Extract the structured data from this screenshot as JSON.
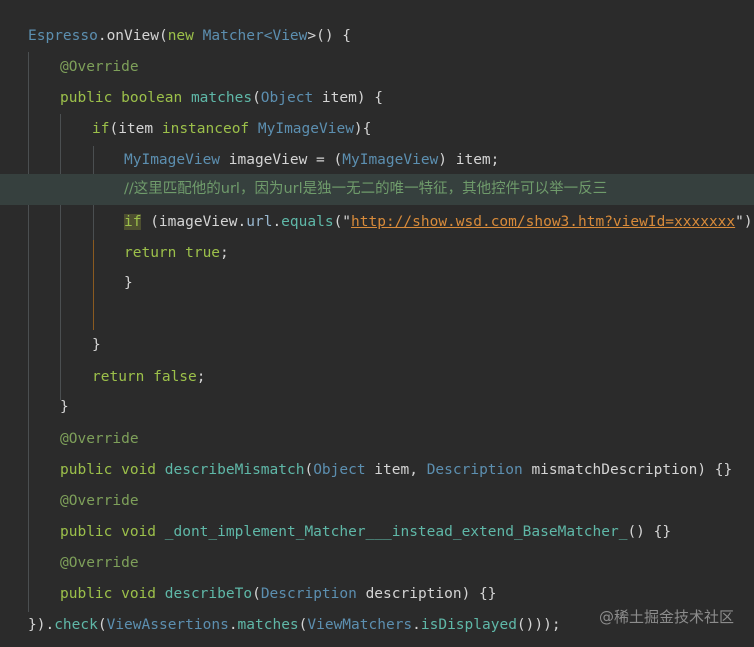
{
  "code": {
    "l1": {
      "a": "Espresso",
      "b": ".",
      "c": "onView",
      "d": "(",
      "e": "new ",
      "f": "Matcher",
      "g": "<",
      "h": "View",
      "i": ">() {"
    },
    "l2": {
      "a": "@Override"
    },
    "l3": {
      "a": "public ",
      "b": "boolean ",
      "c": "matches",
      "d": "(",
      "e": "Object",
      "f": " item) {"
    },
    "l4": {
      "a": "if",
      "b": "(item ",
      "c": "instanceof ",
      "d": "MyImageView",
      "e": "){"
    },
    "l5": {
      "a": "MyImageView",
      "b": " imageView = (",
      "c": "MyImageView",
      "d": ") item;"
    },
    "l6": {
      "a": "//这里匹配他的url，因为url是独一无二的唯一特征，其他控件可以举一反三"
    },
    "l7": {
      "a": "if",
      "b": " (imageView.",
      "c": "url",
      "d": ".",
      "e": "equals",
      "f": "(\"",
      "g": "http://show.wsd.com/show3.htm?viewId=xxxxxxx",
      "h": "\")) {"
    },
    "l8": {
      "a": "return ",
      "b": "true",
      "c": ";"
    },
    "l9": {
      "a": "}"
    },
    "l11": {
      "a": "}"
    },
    "l12": {
      "a": "return ",
      "b": "false",
      "c": ";"
    },
    "l13": {
      "a": "}"
    },
    "l14": {
      "a": "@Override"
    },
    "l15": {
      "a": "public ",
      "b": "void ",
      "c": "describeMismatch",
      "d": "(",
      "e": "Object",
      "f": " item, ",
      "g": "Description",
      "h": " mismatchDescription) {}"
    },
    "l16": {
      "a": "@Override"
    },
    "l17": {
      "a": "public ",
      "b": "void ",
      "c": "_dont_implement_Matcher___instead_extend_BaseMatcher_",
      "d": "() {}"
    },
    "l18": {
      "a": "@Override"
    },
    "l19": {
      "a": "public ",
      "b": "void ",
      "c": "describeTo",
      "d": "(",
      "e": "Description",
      "f": " description) {}"
    },
    "l20": {
      "a": "}).",
      "b": "check",
      "c": "(",
      "d": "ViewAssertions",
      "e": ".",
      "f": "matches",
      "g": "(",
      "h": "ViewMatchers",
      "i": ".",
      "j": "isDisplayed",
      "k": "()));"
    }
  },
  "watermark": "@稀土掘金技术社区",
  "colors": {
    "background": "#2b2b2b",
    "highlight_line": "#36403e",
    "keyword": "#9cc04a",
    "class": "#5c8fb0",
    "string": "#d98b3a",
    "comment": "#6f9b6b"
  }
}
